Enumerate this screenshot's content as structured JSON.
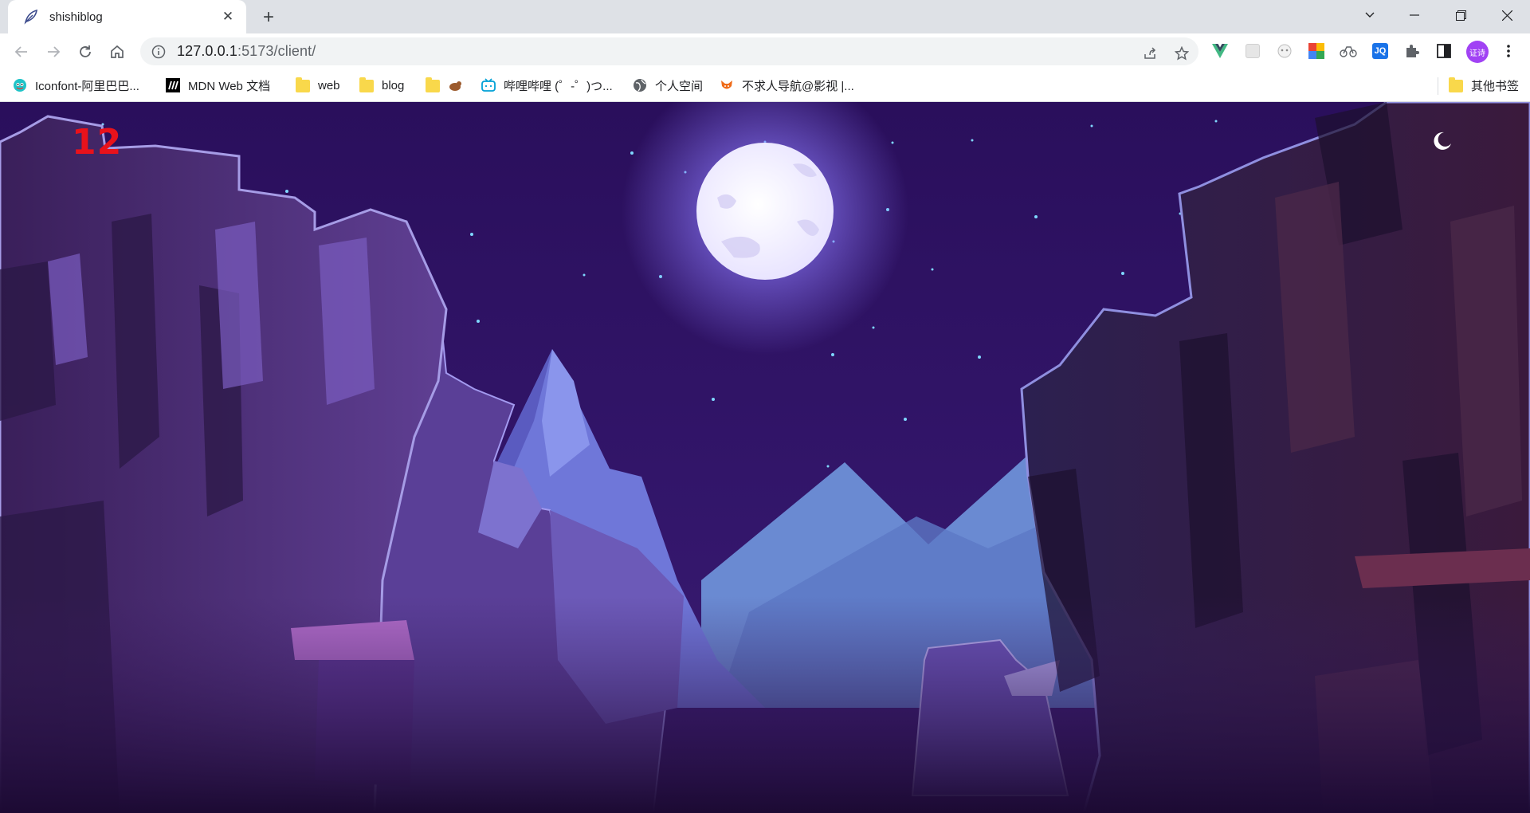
{
  "browser": {
    "tab_title": "shishiblog",
    "url_host": "127.0.0.1",
    "url_path": ":5173/client/",
    "profile_label": "证诗"
  },
  "bookmarks": [
    {
      "label": "Iconfont-阿里巴巴...",
      "icon": "iconfont-icon"
    },
    {
      "label": "MDN Web 文档",
      "icon": "mdn-icon"
    },
    {
      "label": "web",
      "icon": "folder-icon"
    },
    {
      "label": "blog",
      "icon": "folder-icon"
    },
    {
      "label": "",
      "icon": "folder-icon"
    },
    {
      "label": "哔哩哔哩 (゜-゜)つ...",
      "icon": "bilibili-icon"
    },
    {
      "label": "个人空间",
      "icon": "globe-icon"
    },
    {
      "label": "不求人导航@影视 |...",
      "icon": "fox-icon"
    }
  ],
  "other_bookmarks": "其他书签",
  "page": {
    "counter": "12",
    "theme_icon": "moon-icon"
  },
  "colors": {
    "counter": "#e8121b",
    "sky": "#2b1260",
    "moon": "#f4f1ff"
  }
}
